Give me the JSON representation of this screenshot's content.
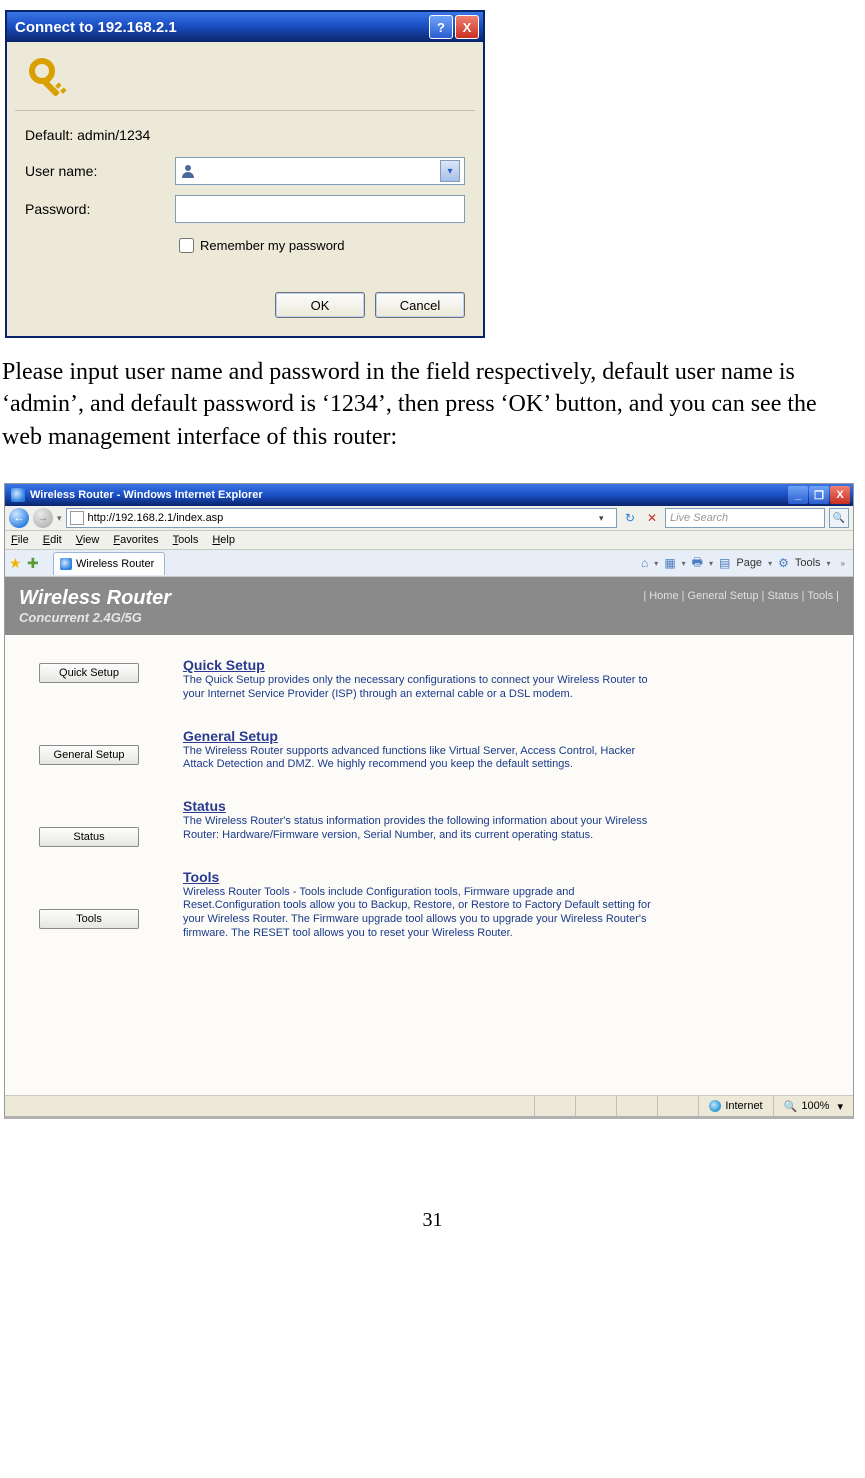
{
  "dialog": {
    "title": "Connect to 192.168.2.1",
    "default_hint": "Default: admin/1234",
    "username_label": "User name:",
    "password_label": "Password:",
    "remember_label": "Remember my password",
    "ok_label": "OK",
    "cancel_label": "Cancel"
  },
  "paragraph": "Please input user name and password in the field respectively, default user name is ‘admin’, and default password is ‘1234’, then press ‘OK’ button, and you can see the web management interface of this router:",
  "browser": {
    "window_title": "Wireless Router - Windows Internet Explorer",
    "url": "http://192.168.2.1/index.asp",
    "search_placeholder": "Live Search",
    "menubar": [
      "File",
      "Edit",
      "View",
      "Favorites",
      "Tools",
      "Help"
    ],
    "tab_label": "Wireless Router",
    "cmd_page": "Page",
    "cmd_tools": "Tools",
    "status_zone": "Internet",
    "status_zoom": "100%"
  },
  "router": {
    "brand": "Wireless Router",
    "subtitle": "Concurrent 2.4G/5G",
    "navlinks": "| Home | General Setup | Status | Tools |",
    "side_buttons": [
      "Quick Setup",
      "General Setup",
      "Status",
      "Tools"
    ],
    "sections": [
      {
        "title": "Quick Setup",
        "body": "The Quick Setup provides only the necessary configurations to connect your Wireless Router to your Internet Service Provider (ISP) through an external cable or a DSL modem."
      },
      {
        "title": "General Setup",
        "body": "The Wireless Router supports advanced functions like Virtual Server, Access Control, Hacker Attack Detection and DMZ. We highly recommend you keep the default settings."
      },
      {
        "title": "Status",
        "body": "The Wireless Router's status information provides the following information about your Wireless Router: Hardware/Firmware version, Serial Number, and its current operating status."
      },
      {
        "title": "Tools",
        "body": "Wireless Router Tools - Tools include Configuration tools, Firmware upgrade and Reset.Configuration tools allow you to Backup, Restore, or Restore to Factory Default setting for your Wireless Router. The Firmware upgrade tool allows you to upgrade your Wireless Router's firmware. The RESET tool allows you to reset your Wireless Router."
      }
    ]
  },
  "page_number": "31"
}
